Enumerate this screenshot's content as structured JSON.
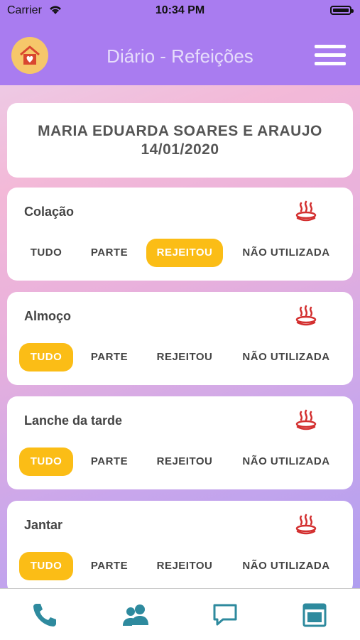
{
  "status": {
    "carrier": "Carrier",
    "time": "10:34 PM"
  },
  "nav": {
    "title": "Diário - Refeições"
  },
  "header": {
    "name": "MARIA EDUARDA SOARES E ARAUJO",
    "date": "14/01/2020"
  },
  "meals": [
    {
      "name": "Colação",
      "options": [
        "TUDO",
        "PARTE",
        "REJEITOU",
        "NÃO UTILIZADA"
      ],
      "selected": "REJEITOU"
    },
    {
      "name": "Almoço",
      "options": [
        "TUDO",
        "PARTE",
        "REJEITOU",
        "NÃO UTILIZADA"
      ],
      "selected": "TUDO"
    },
    {
      "name": "Lanche da tarde",
      "options": [
        "TUDO",
        "PARTE",
        "REJEITOU",
        "NÃO UTILIZADA"
      ],
      "selected": "TUDO"
    },
    {
      "name": "Jantar",
      "options": [
        "TUDO",
        "PARTE",
        "REJEITOU",
        "NÃO UTILIZADA"
      ],
      "selected": "TUDO"
    }
  ],
  "tabs": [
    {
      "icon": "phone-icon"
    },
    {
      "icon": "users-icon"
    },
    {
      "icon": "chat-icon"
    },
    {
      "icon": "calendar-icon"
    }
  ],
  "colors": {
    "accent": "#a97cf0",
    "selected": "#fbbd16",
    "tab_icon": "#2e8a9e",
    "steam": "#d32f2f"
  }
}
